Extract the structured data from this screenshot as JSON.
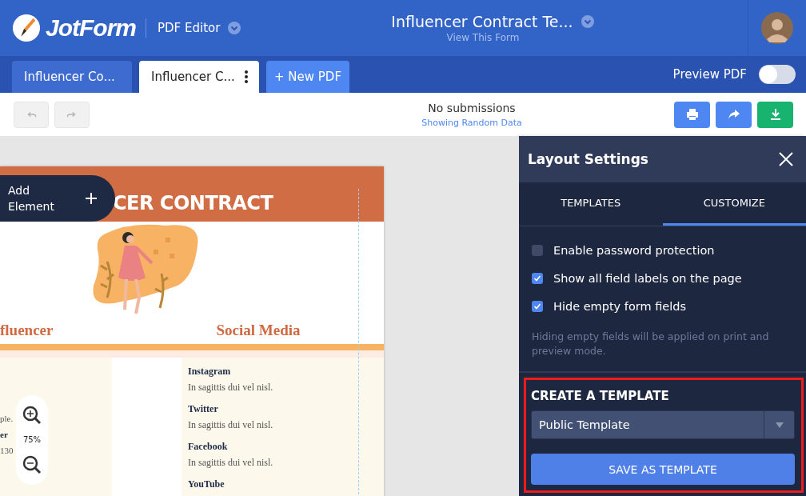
{
  "header": {
    "logo": "JotForm",
    "app": "PDF Editor",
    "form_title": "Influencer Contract Te...",
    "form_link": "View This Form"
  },
  "tabs": [
    {
      "label": "Influencer Co...",
      "selected": false,
      "kind": "document"
    },
    {
      "label": "Influencer C...",
      "selected": true,
      "kind": "document"
    },
    {
      "label": "+ New PDF",
      "selected": false,
      "kind": "new"
    }
  ],
  "preview_pdf": {
    "label": "Preview PDF",
    "on": false
  },
  "toolbar": {
    "undo": {
      "disabled": true
    },
    "redo": {
      "disabled": true
    },
    "status": "No submissions",
    "link": "Showing Random Data"
  },
  "document": {
    "title": "CER CONTRACT",
    "headings": [
      "fluencer",
      "Social Media"
    ],
    "left_column": [
      {
        "text": "ple.",
        "bold": false
      },
      {
        "text": "er",
        "bold": true
      },
      {
        "text": "130",
        "bold": false
      }
    ],
    "social": [
      {
        "name": "Instagram",
        "text": "In sagittis dui vel nisl."
      },
      {
        "name": "Twitter",
        "text": "In sagittis dui vel nisl."
      },
      {
        "name": "Facebook",
        "text": "In sagittis dui vel nisl."
      },
      {
        "name": "YouTube"
      }
    ]
  },
  "add_element": {
    "label": "Add Element"
  },
  "zoom": {
    "reading": "75%"
  },
  "panel": {
    "title": "Layout Settings",
    "tabs": [
      {
        "label": "TEMPLATES",
        "selected": false
      },
      {
        "label": "CUSTOMIZE",
        "selected": true
      }
    ],
    "options": [
      {
        "label": "Enable password protection",
        "checked": false
      },
      {
        "label": "Show all field labels on the page",
        "checked": true
      },
      {
        "label": "Hide empty form fields",
        "checked": true
      }
    ],
    "hint": "Hiding empty fields will be applied on print and preview mode.",
    "section_title": "CREATE A TEMPLATE",
    "select": {
      "value": "Public Template"
    },
    "button": "SAVE AS TEMPLATE"
  }
}
